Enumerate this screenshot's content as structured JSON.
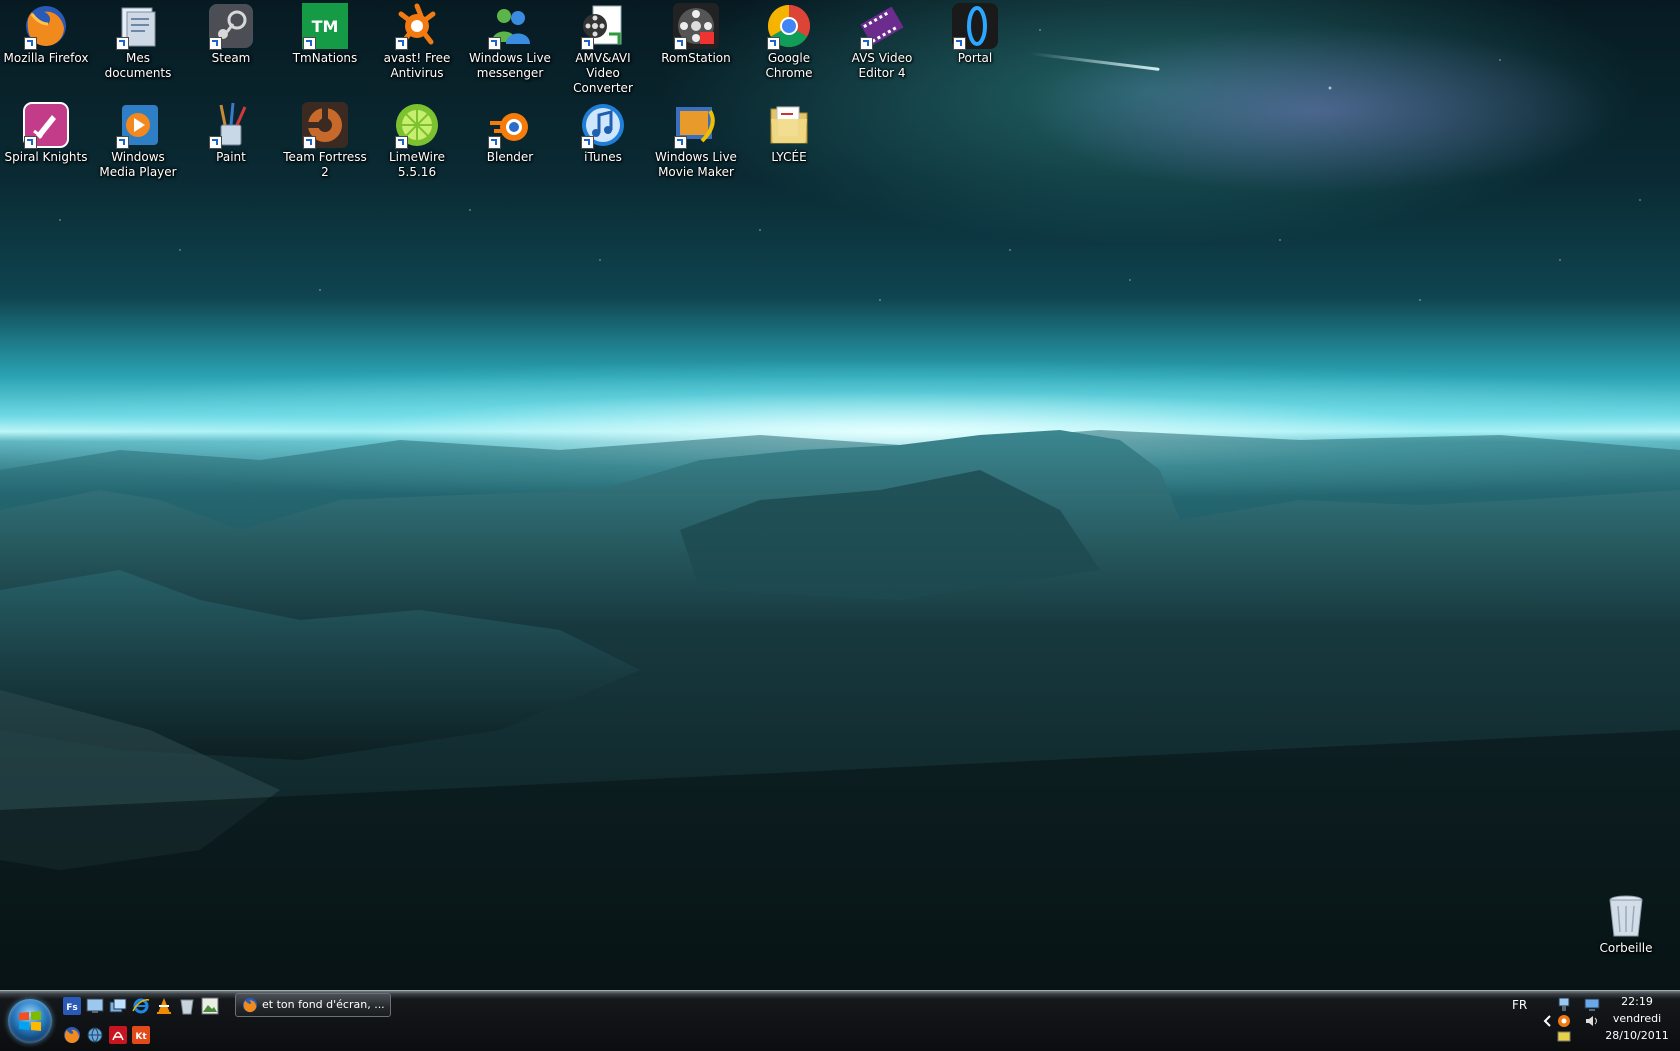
{
  "desktop": {
    "icons": [
      {
        "label": "Mozilla Firefox",
        "icon": "firefox-icon"
      },
      {
        "label": "Mes documents",
        "icon": "documents-folder-icon"
      },
      {
        "label": "Steam",
        "icon": "steam-icon"
      },
      {
        "label": "TmNations",
        "icon": "tmnations-icon"
      },
      {
        "label": "avast! Free Antivirus",
        "icon": "avast-icon"
      },
      {
        "label": "Windows Live messenger",
        "icon": "messenger-icon"
      },
      {
        "label": "AMV&AVI Video Converter",
        "icon": "video-converter-icon"
      },
      {
        "label": "RomStation",
        "icon": "romstation-icon"
      },
      {
        "label": "Google Chrome",
        "icon": "chrome-icon"
      },
      {
        "label": "AVS Video Editor 4",
        "icon": "film-icon"
      },
      {
        "label": "Portal",
        "icon": "portal-icon"
      },
      {
        "label": "Spiral Knights",
        "icon": "spiral-knights-icon"
      },
      {
        "label": "Windows Media Player",
        "icon": "media-player-icon"
      },
      {
        "label": "Paint",
        "icon": "paint-icon"
      },
      {
        "label": "Team Fortress 2",
        "icon": "tf2-icon"
      },
      {
        "label": "LimeWire 5.5.16",
        "icon": "limewire-icon"
      },
      {
        "label": "Blender",
        "icon": "blender-icon"
      },
      {
        "label": "iTunes",
        "icon": "itunes-icon"
      },
      {
        "label": "Windows Live Movie Maker",
        "icon": "movie-maker-icon"
      },
      {
        "label": "LYCÉE",
        "icon": "folder-icon"
      },
      {
        "label": "Corbeille",
        "icon": "recycle-bin-icon"
      }
    ]
  },
  "taskbar": {
    "start_icon": "windows-logo-icon",
    "quicklaunch": [
      "fs-icon",
      "show-desktop-icon",
      "switch-windows-icon",
      "internet-explorer-icon",
      "vlc-icon",
      "trash-icon",
      "image-icon",
      "firefox-icon",
      "globe-icon",
      "acrobat-icon",
      "kt-icon"
    ],
    "task": {
      "label": "et ton fond d'écran, ...",
      "icon": "firefox-icon"
    },
    "language": "FR",
    "clock": {
      "time": "22:19",
      "day": "vendredi",
      "date": "28/10/2011"
    }
  },
  "colors": {
    "taskbar": "#0b0d0f",
    "label_text": "#ffffff",
    "horizon_glow": "#bff6f8"
  }
}
